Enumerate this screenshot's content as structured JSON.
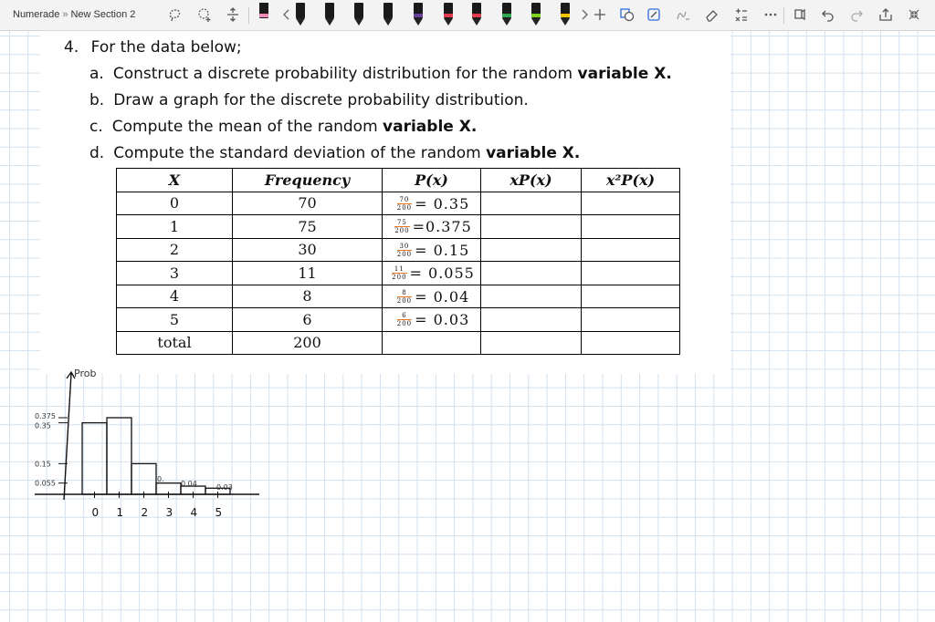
{
  "breadcrumb": {
    "notebook": "Numerade",
    "separator": "»",
    "section": "New Section 2"
  },
  "toolbar": {
    "icons": [
      "lasso-select-icon",
      "add-space-icon",
      "pen-icons",
      "more-chevron-icon",
      "add-pen-icon",
      "shapes-icon",
      "ink-to-text-icon",
      "math-icon",
      "ruler-icon",
      "more-icon",
      "replay-icon",
      "undo-icon",
      "redo-icon",
      "share-icon",
      "fullscreen-icon"
    ],
    "pen_colors": [
      "#222222",
      "#f08ab8",
      "#1a1a1a",
      "#1a1a1a",
      "#1a1a1a",
      "#1a1a1a",
      "#6b3fa0",
      "#e23c4e",
      "#e23c4e",
      "#2fa84f",
      "#7ed321",
      "#f2c400",
      "#2f6ee0"
    ]
  },
  "question": {
    "number": "4.",
    "intro": "For the data below;",
    "items": [
      {
        "letter": "a.",
        "text": "Construct a discrete probability distribution for the random ",
        "bold": "variable X."
      },
      {
        "letter": "b.",
        "text": "Draw a graph for the discrete probability distribution.",
        "bold": ""
      },
      {
        "letter": "c.",
        "text": "Compute the mean of the random ",
        "bold": "variable X."
      },
      {
        "letter": "d.",
        "text": "Compute the standard deviation of the random ",
        "bold": "variable X."
      }
    ]
  },
  "table": {
    "headers": [
      "X",
      "Frequency",
      "P(x)",
      "xP(x)",
      "x²P(x)"
    ],
    "rows": [
      {
        "x": "0",
        "freq": "70",
        "num": "70",
        "den": "200",
        "p": "= 0.35"
      },
      {
        "x": "1",
        "freq": "75",
        "num": "75",
        "den": "200",
        "p": "=0.375"
      },
      {
        "x": "2",
        "freq": "30",
        "num": "30",
        "den": "200",
        "p": "= 0.15"
      },
      {
        "x": "3",
        "freq": "11",
        "num": "11",
        "den": "200",
        "p": "= 0.055"
      },
      {
        "x": "4",
        "freq": "8",
        "num": "8",
        "den": "200",
        "p": "= 0.04"
      },
      {
        "x": "5",
        "freq": "6",
        "num": "6",
        "den": "200",
        "p": "= 0.03"
      }
    ],
    "total_label": "total",
    "total_value": "200"
  },
  "sketch": {
    "ylabel": "Prob",
    "ytick_labels": [
      "0.375",
      "0.35",
      "0.15",
      "0.055"
    ],
    "bar_labels": [
      "0.",
      "0.04",
      "0.03"
    ],
    "xtick_labels": [
      "0",
      "1",
      "2",
      "3",
      "4",
      "5"
    ]
  },
  "chart_data": {
    "type": "bar",
    "categories": [
      "0",
      "1",
      "2",
      "3",
      "4",
      "5"
    ],
    "values": [
      0.35,
      0.375,
      0.15,
      0.055,
      0.04,
      0.03
    ],
    "ylabel": "Prob",
    "ylim": [
      0,
      0.4
    ]
  }
}
